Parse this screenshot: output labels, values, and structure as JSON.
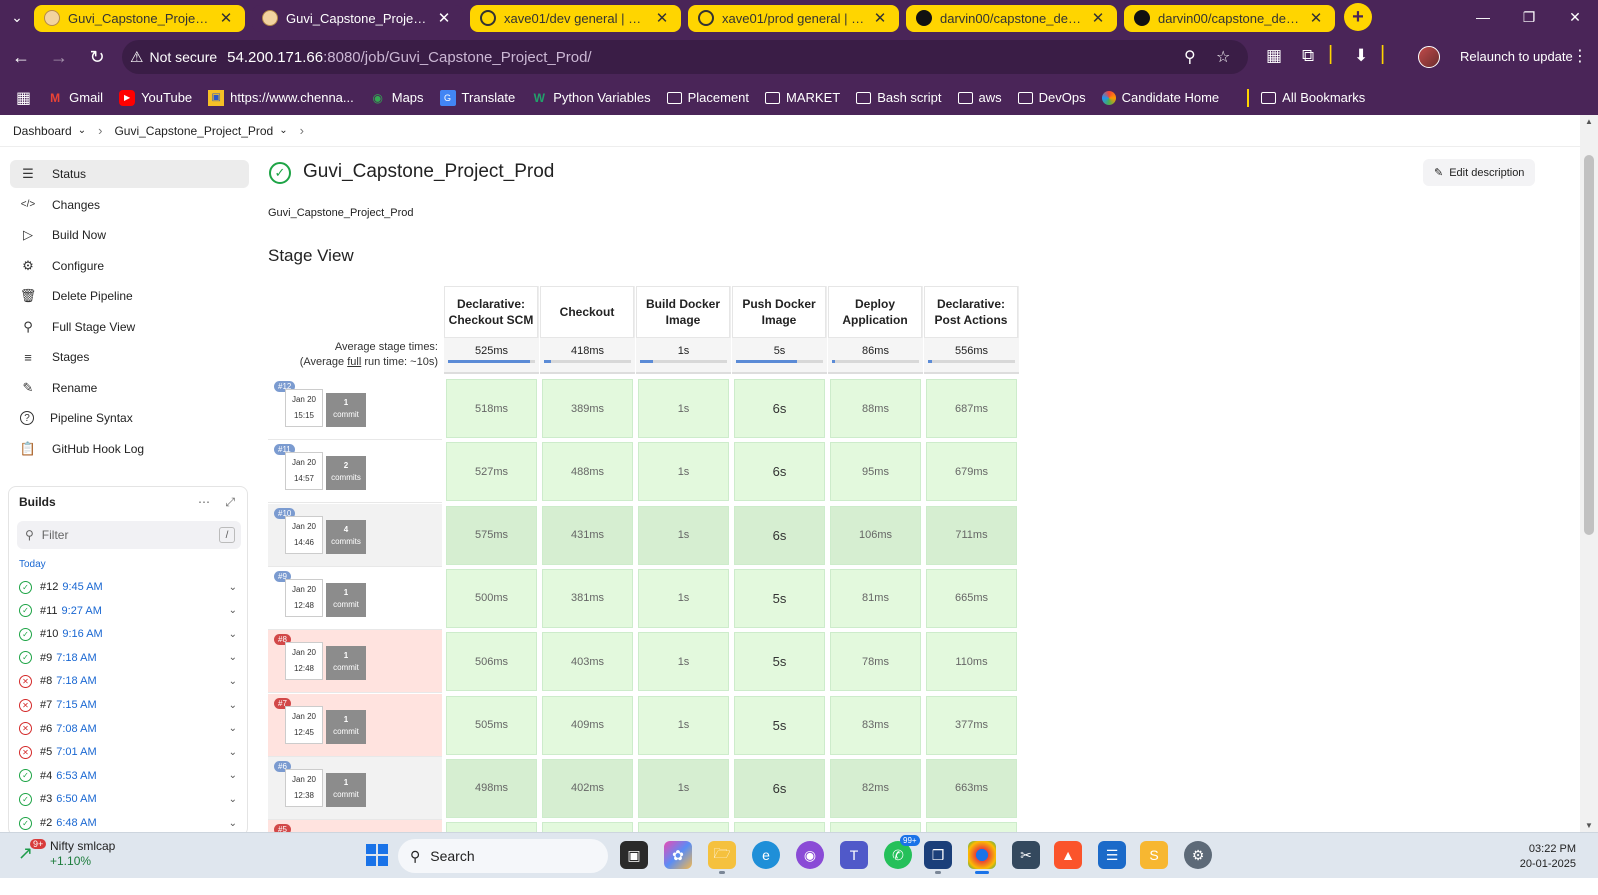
{
  "browser": {
    "tabs": [
      {
        "title": "Guvi_Capstone_Project_dev [",
        "icon": "jenkins-icon",
        "active": false
      },
      {
        "title": "Guvi_Capstone_Project_Prod",
        "icon": "jenkins-icon",
        "active": true
      },
      {
        "title": "xave01/dev general | Docker",
        "icon": "docker-icon",
        "active": false
      },
      {
        "title": "xave01/prod general | Docke",
        "icon": "docker-icon",
        "active": false
      },
      {
        "title": "darvin00/capstone_devops-t",
        "icon": "github-icon",
        "active": false
      },
      {
        "title": "darvin00/capstone_devops-t",
        "icon": "github-icon",
        "active": false
      }
    ],
    "security_label": "Not secure",
    "url_host": "54.200.171.66",
    "url_path": ":8080/job/Guvi_Capstone_Project_Prod/",
    "relaunch_label": "Relaunch to update",
    "bookmarks": [
      {
        "label": "Gmail",
        "icon": "gmail-icon"
      },
      {
        "label": "YouTube",
        "icon": "youtube-icon"
      },
      {
        "label": "https://www.chenna...",
        "icon": "site-icon"
      },
      {
        "label": "Maps",
        "icon": "maps-icon"
      },
      {
        "label": "Translate",
        "icon": "translate-icon"
      },
      {
        "label": "Python Variables",
        "icon": "site-icon"
      },
      {
        "label": "Placement",
        "icon": "folder-icon"
      },
      {
        "label": "MARKET",
        "icon": "folder-icon"
      },
      {
        "label": "Bash script",
        "icon": "folder-icon"
      },
      {
        "label": "aws",
        "icon": "folder-icon"
      },
      {
        "label": "DevOps",
        "icon": "folder-icon"
      },
      {
        "label": "Candidate Home",
        "icon": "site-icon"
      }
    ],
    "all_bookmarks_label": "All Bookmarks"
  },
  "breadcrumb": {
    "root": "Dashboard",
    "job": "Guvi_Capstone_Project_Prod"
  },
  "sidebar": {
    "items": [
      {
        "label": "Status",
        "icon": "document-icon",
        "active": true
      },
      {
        "label": "Changes",
        "icon": "code-icon"
      },
      {
        "label": "Build Now",
        "icon": "play-icon"
      },
      {
        "label": "Configure",
        "icon": "gear-icon"
      },
      {
        "label": "Delete Pipeline",
        "icon": "trash-icon"
      },
      {
        "label": "Full Stage View",
        "icon": "search-icon"
      },
      {
        "label": "Stages",
        "icon": "layers-icon"
      },
      {
        "label": "Rename",
        "icon": "pencil-icon"
      },
      {
        "label": "Pipeline Syntax",
        "icon": "help-icon"
      },
      {
        "label": "GitHub Hook Log",
        "icon": "clipboard-icon"
      }
    ]
  },
  "builds": {
    "title": "Builds",
    "filter_placeholder": "Filter",
    "filter_shortcut": "/",
    "group_label": "Today",
    "items": [
      {
        "number": "#12",
        "time": "9:45 AM",
        "status": "success"
      },
      {
        "number": "#11",
        "time": "9:27 AM",
        "status": "success"
      },
      {
        "number": "#10",
        "time": "9:16 AM",
        "status": "success"
      },
      {
        "number": "#9",
        "time": "7:18 AM",
        "status": "success"
      },
      {
        "number": "#8",
        "time": "7:18 AM",
        "status": "failure"
      },
      {
        "number": "#7",
        "time": "7:15 AM",
        "status": "failure"
      },
      {
        "number": "#6",
        "time": "7:08 AM",
        "status": "failure"
      },
      {
        "number": "#5",
        "time": "7:01 AM",
        "status": "failure"
      },
      {
        "number": "#4",
        "time": "6:53 AM",
        "status": "success"
      },
      {
        "number": "#3",
        "time": "6:50 AM",
        "status": "success"
      },
      {
        "number": "#2",
        "time": "6:48 AM",
        "status": "success"
      }
    ]
  },
  "main": {
    "title": "Guvi_Capstone_Project_Prod",
    "edit_description_label": "Edit description",
    "description": "Guvi_Capstone_Project_Prod",
    "stage_view_heading": "Stage View"
  },
  "stage_view": {
    "avg_label_1": "Average stage times:",
    "avg_label_2_pre": "(Average ",
    "avg_label_2_full": "full",
    "avg_label_2_post": " run time: ~10s)",
    "stages": [
      {
        "name_1": "Declarative:",
        "name_2": "Checkout SCM",
        "avg": "525ms",
        "avg_fraction": 0.94
      },
      {
        "name_1": "Checkout",
        "name_2": "",
        "avg": "418ms",
        "avg_fraction": 0.08
      },
      {
        "name_1": "Build Docker",
        "name_2": "Image",
        "avg": "1s",
        "avg_fraction": 0.15
      },
      {
        "name_1": "Push Docker",
        "name_2": "Image",
        "avg": "5s",
        "avg_fraction": 0.7
      },
      {
        "name_1": "Deploy",
        "name_2": "Application",
        "avg": "86ms",
        "avg_fraction": 0.02
      },
      {
        "name_1": "Declarative:",
        "name_2": "Post Actions",
        "avg": "556ms",
        "avg_fraction": 0.05
      }
    ],
    "runs": [
      {
        "badge": "#12",
        "date": "Jan 20",
        "time": "15:15",
        "commit_count": "1",
        "commit_word": "commit",
        "failed": false,
        "times": [
          "518ms",
          "389ms",
          "1s",
          "6s",
          "88ms",
          "687ms"
        ]
      },
      {
        "badge": "#11",
        "date": "Jan 20",
        "time": "14:57",
        "commit_count": "2",
        "commit_word": "commits",
        "failed": false,
        "times": [
          "527ms",
          "488ms",
          "1s",
          "6s",
          "95ms",
          "679ms"
        ]
      },
      {
        "badge": "#10",
        "date": "Jan 20",
        "time": "14:46",
        "commit_count": "4",
        "commit_word": "commits",
        "failed": false,
        "times": [
          "575ms",
          "431ms",
          "1s",
          "6s",
          "106ms",
          "711ms"
        ]
      },
      {
        "badge": "#9",
        "date": "Jan 20",
        "time": "12:48",
        "commit_count": "1",
        "commit_word": "commit",
        "failed": false,
        "times": [
          "500ms",
          "381ms",
          "1s",
          "5s",
          "81ms",
          "665ms"
        ]
      },
      {
        "badge": "#8",
        "date": "Jan 20",
        "time": "12:48",
        "commit_count": "1",
        "commit_word": "commit",
        "failed": true,
        "times": [
          "506ms",
          "403ms",
          "1s",
          "5s",
          "78ms",
          "110ms"
        ]
      },
      {
        "badge": "#7",
        "date": "Jan 20",
        "time": "12:45",
        "commit_count": "1",
        "commit_word": "commit",
        "failed": true,
        "times": [
          "505ms",
          "409ms",
          "1s",
          "5s",
          "83ms",
          "377ms"
        ]
      },
      {
        "badge": "#6",
        "date": "Jan 20",
        "time": "12:38",
        "commit_count": "1",
        "commit_word": "commit",
        "failed": false,
        "times": [
          "498ms",
          "402ms",
          "1s",
          "6s",
          "82ms",
          "663ms"
        ]
      },
      {
        "badge": "#5",
        "date": "",
        "time": "",
        "commit_count": "",
        "commit_word": "",
        "failed": true,
        "times": [
          "",
          "",
          "",
          "",
          "",
          ""
        ]
      }
    ]
  },
  "taskbar": {
    "widget_title": "Nifty smlcap",
    "widget_change": "+1.10%",
    "widget_badge": "9+",
    "search_label": "Search",
    "teams_badge": "99+",
    "clock_time": "03:22 PM",
    "clock_date": "20-01-2025"
  }
}
